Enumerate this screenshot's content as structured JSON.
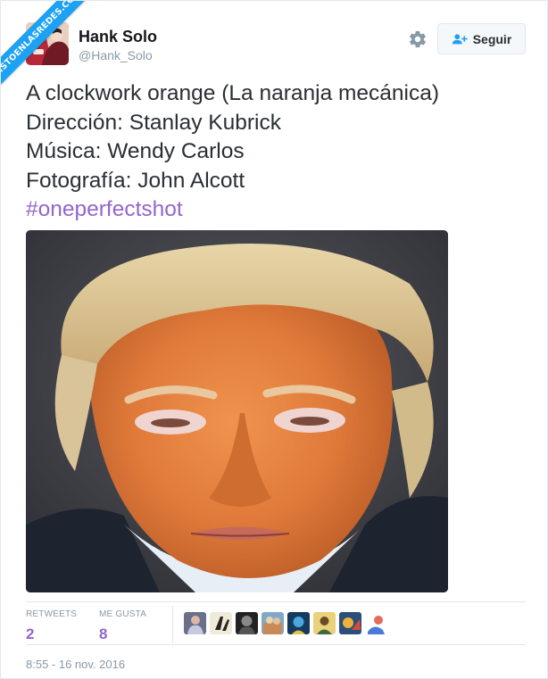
{
  "watermark": {
    "text": "VISTOENLASREDES.COM"
  },
  "author": {
    "name": "Hank Solo",
    "handle": "@Hank_Solo",
    "avatar_icon": "avatar-photo"
  },
  "actions": {
    "settings_icon": "gear-icon",
    "follow_icon": "add-user-icon",
    "follow_label": "Seguir"
  },
  "tweet": {
    "lines": [
      "A clockwork orange (La naranja mecánica)",
      "Dirección: Stanlay Kubrick",
      "Música: Wendy Carlos",
      "Fotografía: John Alcott"
    ],
    "hashtag": "#oneperfectshot",
    "photo_icon": "photo-orange-face"
  },
  "stats": {
    "retweets_label": "RETWEETS",
    "retweets_value": "2",
    "likes_label": "ME GUSTA",
    "likes_value": "8"
  },
  "likers": [
    "liker-avatar-1",
    "liker-avatar-2",
    "liker-avatar-3",
    "liker-avatar-4",
    "liker-avatar-5",
    "liker-avatar-6",
    "liker-avatar-7",
    "liker-avatar-8"
  ],
  "timestamp": "8:55 - 16 nov. 2016",
  "colors": {
    "accent": "#9266cc",
    "muted": "#8899a6",
    "border": "#e1e8ed",
    "ribbon": "#1da1f2"
  }
}
